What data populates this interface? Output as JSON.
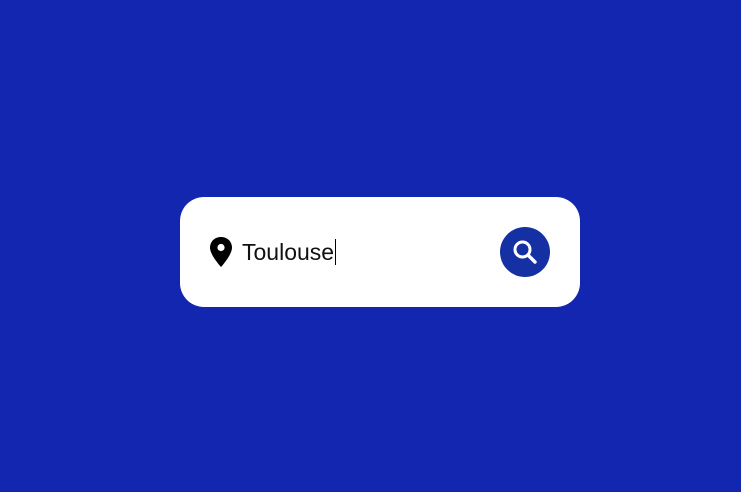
{
  "search": {
    "value": "Toulouse",
    "location_icon": "map-pin-icon",
    "button_icon": "search-icon"
  },
  "colors": {
    "background": "#1226b0",
    "card": "#ffffff",
    "button": "#1530a3",
    "text": "#111111"
  }
}
